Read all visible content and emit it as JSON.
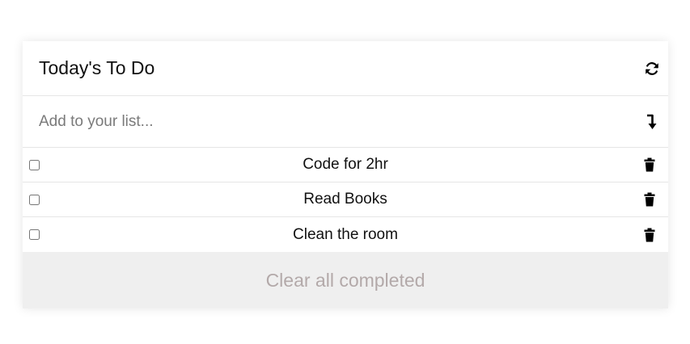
{
  "header": {
    "title": "Today's To Do",
    "refresh_icon": "refresh-icon"
  },
  "add": {
    "placeholder": "Add to your list...",
    "submit_icon": "enter-arrow-icon"
  },
  "todos": [
    {
      "text": "Code for 2hr",
      "checked": false
    },
    {
      "text": "Read Books",
      "checked": false
    },
    {
      "text": "Clean the room",
      "checked": false
    }
  ],
  "footer": {
    "clear_label": "Clear all completed"
  },
  "colors": {
    "footer_bg": "#efefef",
    "footer_text": "#b3a9a9",
    "divider": "#e6e6e6"
  }
}
